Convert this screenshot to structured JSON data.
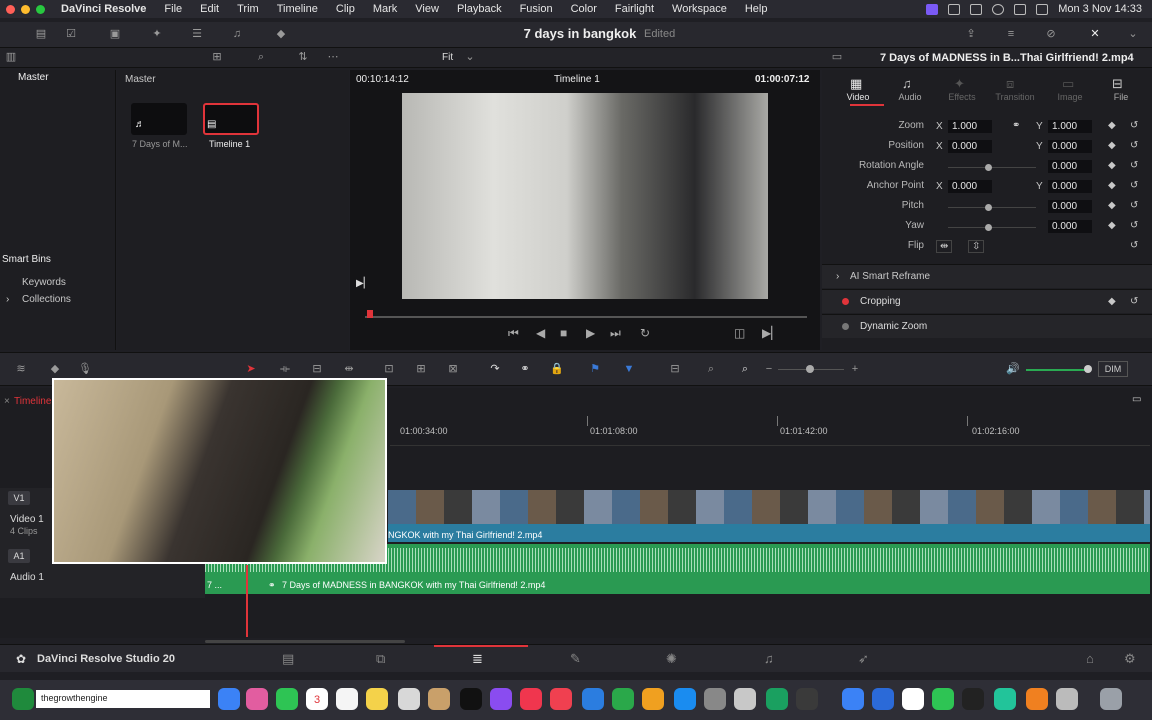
{
  "menubar": {
    "items": [
      "DaVinci Resolve",
      "File",
      "Edit",
      "Trim",
      "Timeline",
      "Clip",
      "Mark",
      "View",
      "Playback",
      "Fusion",
      "Color",
      "Fairlight",
      "Workspace",
      "Help"
    ],
    "clock": "Mon 3 Nov  14:33"
  },
  "toolbar": {
    "project_title": "7 days in bangkok",
    "status": "Edited"
  },
  "media": {
    "header": "Master",
    "folder": "Master",
    "smart_bins_label": "Smart Bins",
    "smart_bins": [
      "Keywords",
      "Collections"
    ],
    "clips": [
      {
        "name": "7 Days of M..."
      },
      {
        "name": "Timeline 1"
      }
    ]
  },
  "viewer": {
    "timecode_left": "00:10:14:12",
    "timeline_name": "Timeline 1",
    "timecode_right": "01:00:07:12",
    "zoom": "Fit"
  },
  "inspector": {
    "clip_title": "7 Days of MADNESS in B...Thai Girlfriend! 2.mp4",
    "tabs": [
      "Video",
      "Audio",
      "Effects",
      "Transition",
      "Image",
      "File"
    ],
    "active_tab": "Video",
    "props": {
      "zoom_label": "Zoom",
      "zoom_x": "1.000",
      "zoom_y": "1.000",
      "position_label": "Position",
      "position_x": "0.000",
      "position_y": "0.000",
      "rotation_label": "Rotation Angle",
      "rotation": "0.000",
      "anchor_label": "Anchor Point",
      "anchor_x": "0.000",
      "anchor_y": "0.000",
      "pitch_label": "Pitch",
      "pitch": "0.000",
      "yaw_label": "Yaw",
      "yaw": "0.000",
      "flip_label": "Flip",
      "x_label": "X",
      "y_label": "Y"
    },
    "sections": [
      "AI Smart Reframe",
      "Cropping",
      "Dynamic Zoom"
    ]
  },
  "timeline": {
    "tab_label": "Timeline",
    "timecodes": [
      "01:00:34:00",
      "01:01:08:00",
      "01:01:42:00",
      "01:02:16:00"
    ],
    "tracks": {
      "v1": {
        "badge": "V1",
        "name": "Video 1",
        "clips": "4 Clips"
      },
      "a1": {
        "badge": "A1",
        "name": "Audio 1"
      }
    },
    "video_clip_label": "NGKOK with my Thai Girlfriend! 2.mp4",
    "audio_clip_label": "7 Days of MADNESS in BANGKOK with my Thai Girlfriend! 2.mp4",
    "audio_clip_short": "7 ...",
    "dim_label": "DIM"
  },
  "bottombar": {
    "app_name": "DaVinci Resolve Studio 20"
  },
  "dock": {
    "input_text": "thegrowthengine",
    "calendar_day": "3"
  },
  "colors": {
    "accent": "#e0343a",
    "video_clip": "#2b7da0",
    "audio_clip": "#2a9a52"
  }
}
